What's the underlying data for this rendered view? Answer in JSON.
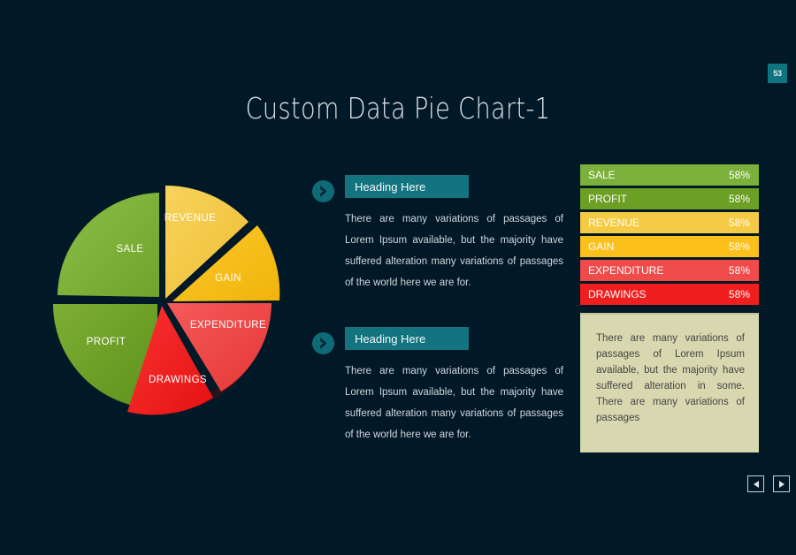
{
  "slide": {
    "title": "Custom Data Pie Chart-1",
    "page_number": "53",
    "background_color": "#011827",
    "accent_color": "#13737E"
  },
  "content_blocks": [
    {
      "icon": "chevron-right-circle-icon",
      "heading": "Heading Here",
      "body": "There are many variations of passages of Lorem Ipsum available, but the majority have suffered alteration many variations of passages of the world here we are for."
    },
    {
      "icon": "chevron-right-circle-icon",
      "heading": "Heading Here",
      "body": "There are many variations of passages of Lorem Ipsum available, but the majority have suffered alteration many variations of passages of the world here we are for."
    }
  ],
  "note_box": {
    "text": "There are many variations of passages of Lorem Ipsum available, but the majority have suffered alteration in some. There are many variations of passages",
    "background_color": "#D8D8B0"
  },
  "navigation": {
    "previous_label": "Previous",
    "next_label": "Next"
  },
  "chart_data": {
    "type": "pie",
    "title": "Custom Data Pie Chart-1",
    "categories": [
      "SALE",
      "PROFIT",
      "REVENUE",
      "GAIN",
      "EXPENDITURE",
      "DRAWINGS"
    ],
    "values": [
      58,
      58,
      58,
      58,
      58,
      58
    ],
    "value_labels": [
      "58%",
      "58%",
      "58%",
      "58%",
      "58%",
      "58%"
    ],
    "colors": [
      "#7BB03A",
      "#6BA024",
      "#F5CB46",
      "#FBC01B",
      "#F04B4B",
      "#F01E1E"
    ],
    "unit": "%",
    "legend": "right",
    "exploded_slices": [
      "GAIN",
      "DRAWINGS"
    ],
    "style": "3d-pie",
    "slice_order_clockwise": [
      "REVENUE",
      "GAIN",
      "EXPENDITURE",
      "DRAWINGS",
      "PROFIT",
      "SALE"
    ]
  }
}
